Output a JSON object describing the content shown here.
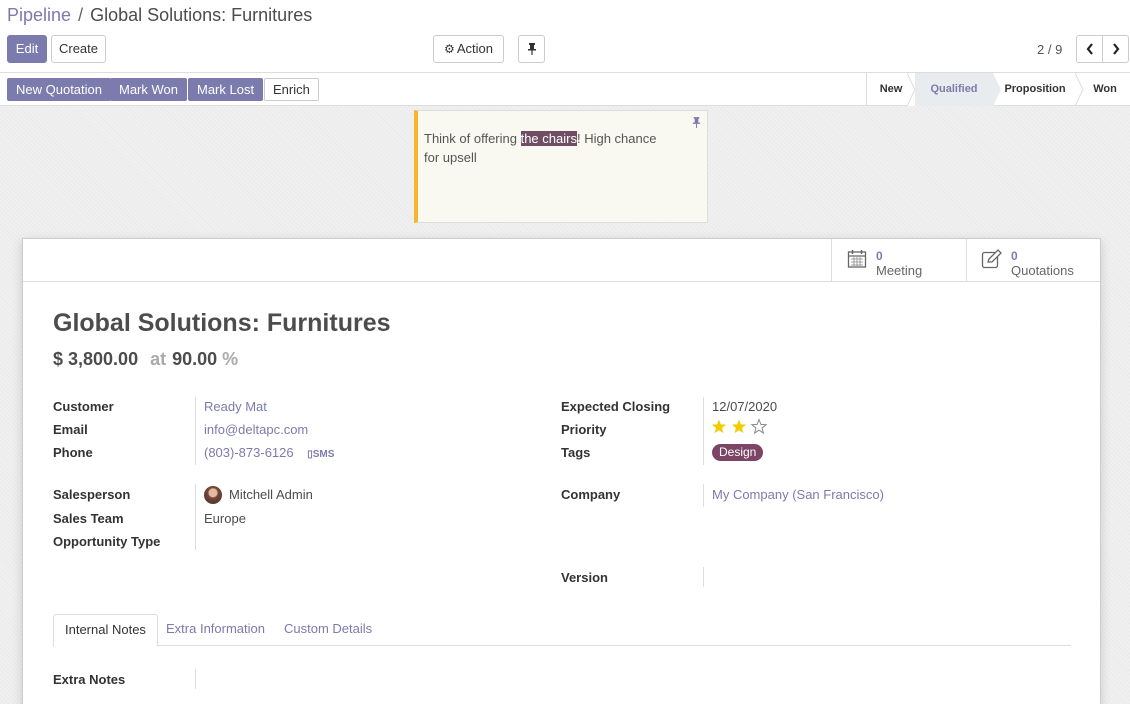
{
  "breadcrumb": {
    "parent": "Pipeline",
    "separator": "/",
    "current": "Global Solutions: Furnitures"
  },
  "toolbar": {
    "edit_label": "Edit",
    "create_label": "Create",
    "action_label": "Action",
    "pager": "2 / 9"
  },
  "header_buttons": {
    "new_quotation": "New Quotation",
    "mark_won": "Mark Won",
    "mark_lost": "Mark Lost",
    "enrich": "Enrich"
  },
  "stages": {
    "items": [
      "New",
      "Qualified",
      "Proposition",
      "Won"
    ],
    "active": "Qualified"
  },
  "note": {
    "before": "Think of offering ",
    "highlight": "the chairs",
    "after": "! High chance for upsell"
  },
  "smart_buttons": {
    "meeting": {
      "count": "0",
      "label": "Meeting",
      "icon": "calendar-icon"
    },
    "quotations": {
      "count": "0",
      "label": "Quotations",
      "icon": "edit-icon"
    }
  },
  "record": {
    "title": "Global Solutions: Furnitures",
    "revenue": "$ 3,800.00",
    "at": "at",
    "probability": "90.00",
    "percent": "%"
  },
  "fields": {
    "customer_label": "Customer",
    "customer": "Ready Mat",
    "email_label": "Email",
    "email": "info@deltapc.com",
    "phone_label": "Phone",
    "phone": "(803)-873-6126",
    "sms": "SMS",
    "salesperson_label": "Salesperson",
    "salesperson": "Mitchell Admin",
    "team_label": "Sales Team",
    "team": "Europe",
    "opp_type_label": "Opportunity Type",
    "closing_label": "Expected Closing",
    "closing": "12/07/2020",
    "priority_label": "Priority",
    "priority_stars": 2,
    "priority_max": 3,
    "tags_label": "Tags",
    "tag": "Design",
    "tag_color": "#7c4565",
    "company_label": "Company",
    "company": "My Company (San Francisco)",
    "version_label": "Version"
  },
  "tabs": [
    "Internal Notes",
    "Extra Information",
    "Custom Details"
  ],
  "notes": {
    "extra_notes_label": "Extra Notes"
  },
  "colors": {
    "primary": "#7c7bad",
    "star": "#f3cc00",
    "note_border": "#f5b62c"
  }
}
